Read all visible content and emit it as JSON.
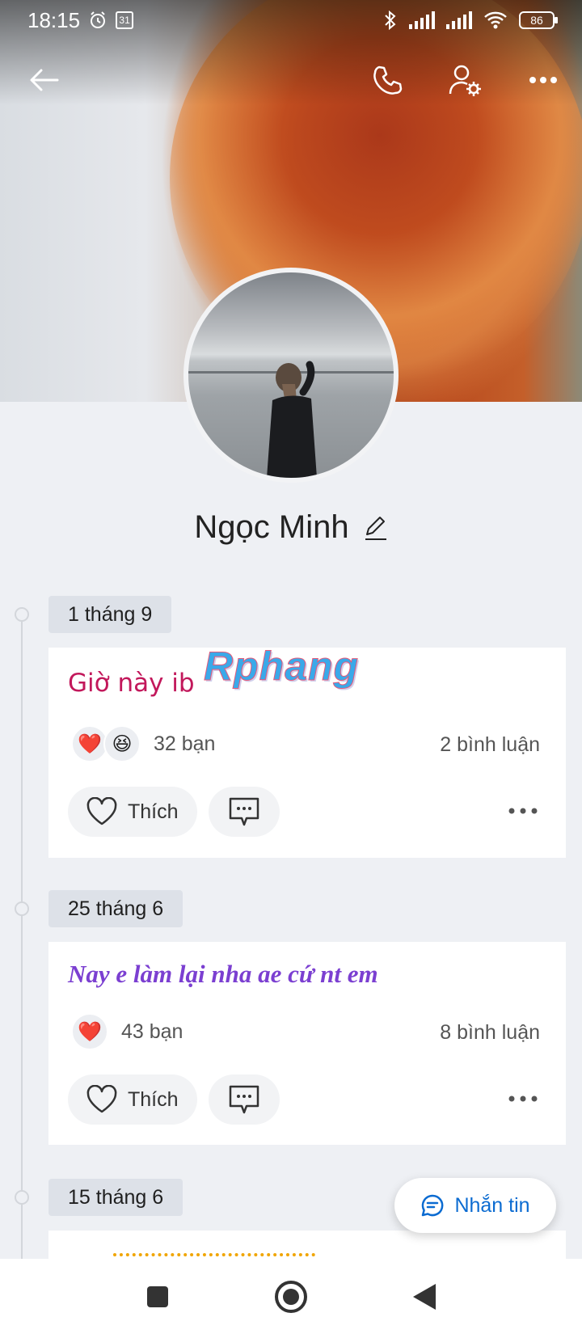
{
  "status_bar": {
    "time": "18:15",
    "calendar_day": "31",
    "battery": "86"
  },
  "profile": {
    "name": "Ngọc Minh"
  },
  "watermark": "Rphang",
  "posts": [
    {
      "date": "1 tháng 9",
      "text": "Giờ này ib",
      "text_color": "#c2185b",
      "reactions": [
        "heart",
        "laugh"
      ],
      "react_count": "32 bạn",
      "comment_count": "2 bình luận",
      "like_label": "Thích"
    },
    {
      "date": "25 tháng 6",
      "text": "Nay e làm lại nha ae cứ nt em",
      "text_color": "#7b3fd1",
      "reactions": [
        "heart"
      ],
      "react_count": "43 bạn",
      "comment_count": "8 bình luận",
      "like_label": "Thích"
    },
    {
      "date": "15 tháng 6"
    }
  ],
  "fab": {
    "label": "Nhắn tin"
  },
  "colors": {
    "accent": "#0b6bd1",
    "background": "#eef0f4"
  }
}
